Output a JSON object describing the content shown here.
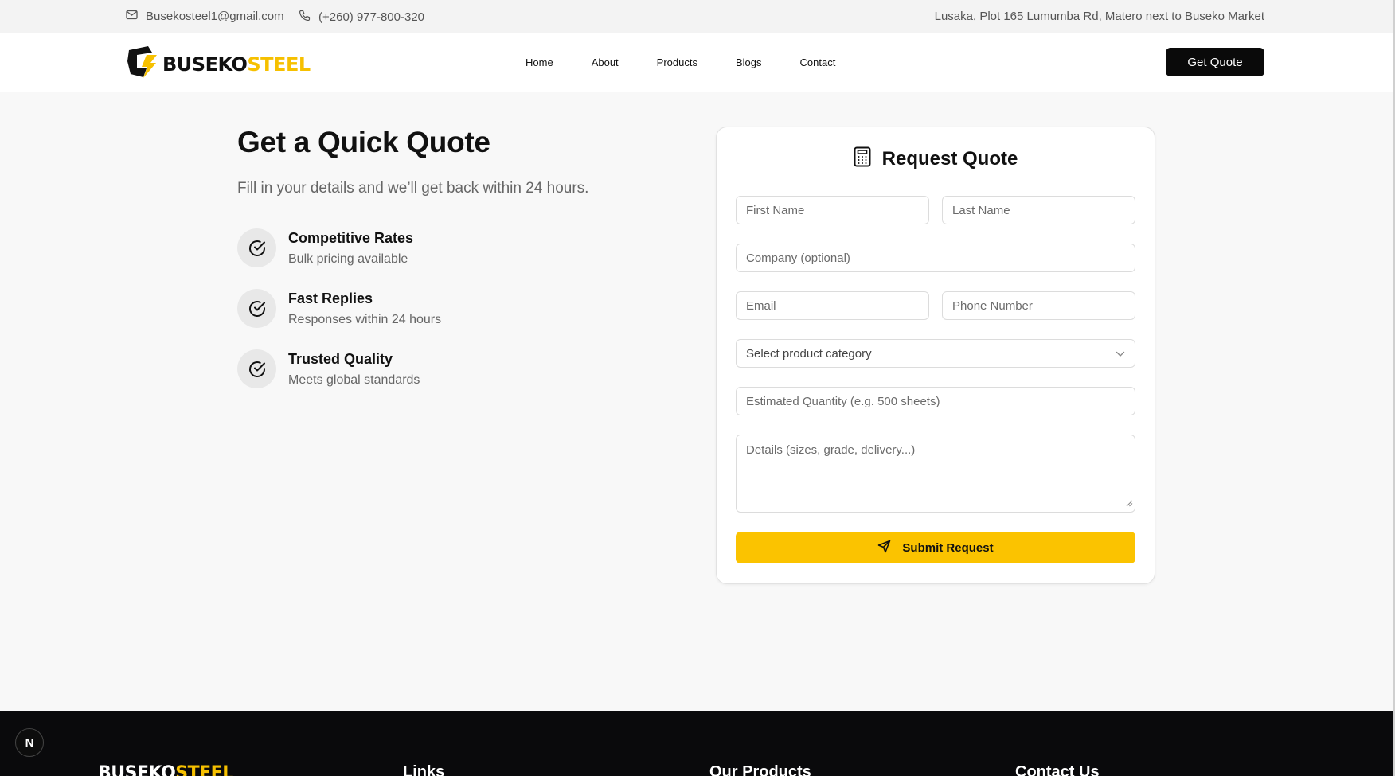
{
  "topbar": {
    "email": "Busekosteel1@gmail.com",
    "phone": "(+260) 977-800-320",
    "address": "Lusaka, Plot 165 Lumumba Rd, Matero next to Buseko Market"
  },
  "brand": {
    "name_part1": "BUSEKO",
    "name_part2": "STEEL",
    "accent_color": "#f6c000"
  },
  "nav": {
    "items": [
      {
        "label": "Home"
      },
      {
        "label": "About"
      },
      {
        "label": "Products"
      },
      {
        "label": "Blogs"
      },
      {
        "label": "Contact"
      }
    ],
    "cta_label": "Get Quote"
  },
  "hero": {
    "title": "Get a Quick Quote",
    "subtitle": "Fill in your details and we’ll get back within 24 hours.",
    "features": [
      {
        "title": "Competitive Rates",
        "desc": "Bulk pricing available",
        "icon": "check-circle-icon"
      },
      {
        "title": "Fast Replies",
        "desc": "Responses within 24 hours",
        "icon": "check-circle-icon"
      },
      {
        "title": "Trusted Quality",
        "desc": "Meets global standards",
        "icon": "check-circle-icon"
      }
    ]
  },
  "form": {
    "title": "Request Quote",
    "title_icon": "calculator-icon",
    "first_name_placeholder": "First Name",
    "last_name_placeholder": "Last Name",
    "company_placeholder": "Company (optional)",
    "email_placeholder": "Email",
    "phone_placeholder": "Phone Number",
    "category_selected": "Select product category",
    "quantity_placeholder": "Estimated Quantity (e.g. 500 sheets)",
    "details_placeholder": "Details (sizes, grade, delivery...)",
    "submit_label": "Submit Request",
    "submit_color": "#fbc300"
  },
  "footer": {
    "brand_part1": "BUSEKO",
    "brand_part2": "STEEL",
    "links_heading": "Links",
    "products_heading": "Our Products",
    "contact_heading": "Contact Us"
  },
  "dev_badge": "N"
}
